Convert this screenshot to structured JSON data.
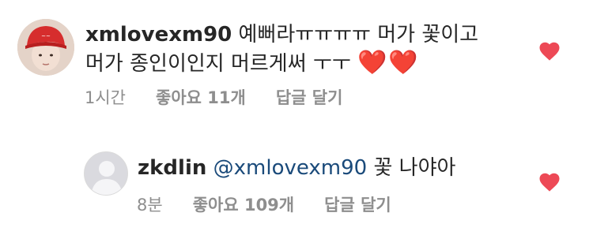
{
  "comment1": {
    "username": "xmlovexm90",
    "text_line1": "예뻐라ㅠㅠㅠㅠ 머가 꽃이고",
    "text_line2": "머가 종인이인지 머르게써 ㅜㅜ",
    "hearts": "❤️❤️",
    "time": "1시간",
    "likes": "좋아요 11개",
    "reply": "답글 달기"
  },
  "comment2": {
    "username": "zkdlin",
    "mention": "@xmlovexm90",
    "text": "꽃 나야아",
    "time": "8분",
    "likes": "좋아요 109개",
    "reply": "답글 달기"
  },
  "colors": {
    "heart": "#ed4956",
    "meta_text": "#8e8e8e",
    "mention": "#1a4a7a"
  },
  "icons": {
    "like": "heart-icon",
    "avatar_placeholder": "default-user-icon"
  }
}
